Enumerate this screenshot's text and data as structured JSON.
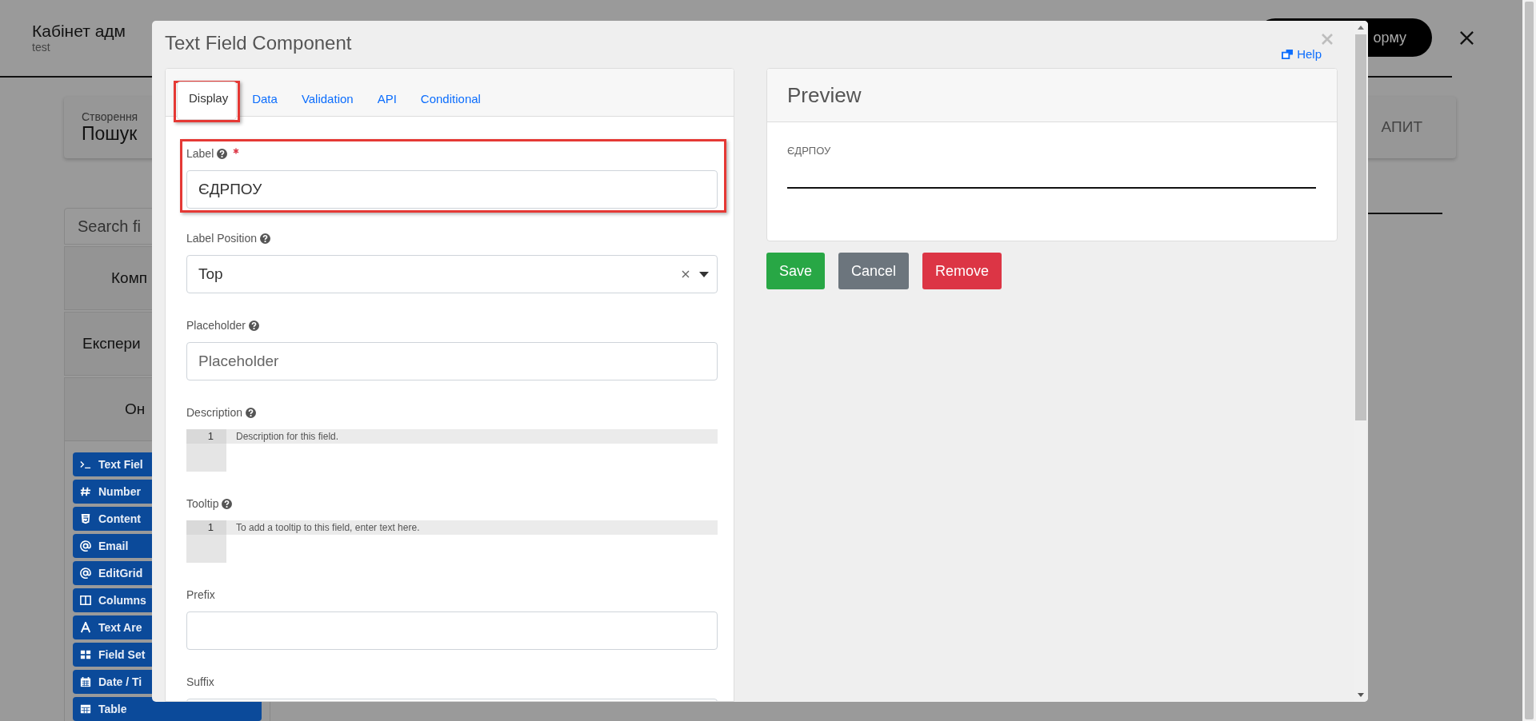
{
  "page": {
    "title": "Кабінет адм",
    "subtitle": "test",
    "header_button": "орму"
  },
  "form_card": {
    "caption": "Створення",
    "title": "Пошук",
    "action": "АПИТ"
  },
  "sidebar": {
    "search": {
      "placeholder": "Search fi"
    },
    "groups": [
      {
        "label": "Комп"
      },
      {
        "label": "Експери"
      },
      {
        "label": "Он"
      }
    ],
    "items": [
      {
        "label": "Text Fiel",
        "kind": "terminal"
      },
      {
        "label": "Number",
        "kind": "hash"
      },
      {
        "label": "Content",
        "kind": "html"
      },
      {
        "label": "Email",
        "kind": "at"
      },
      {
        "label": "EditGrid",
        "kind": "at"
      },
      {
        "label": "Columns",
        "kind": "columns"
      },
      {
        "label": "Text Are",
        "kind": "font"
      },
      {
        "label": "Field Set",
        "kind": "grid"
      },
      {
        "label": "Date / Ti",
        "kind": "calendar"
      },
      {
        "label": "Table",
        "kind": "table"
      }
    ]
  },
  "modal": {
    "title": "Text Field Component",
    "help": "Help",
    "tabs": [
      {
        "label": "Display",
        "selected": true,
        "highlighted": true
      },
      {
        "label": "Data",
        "selected": false,
        "highlighted": false
      },
      {
        "label": "Validation",
        "selected": false,
        "highlighted": false
      },
      {
        "label": "API",
        "selected": false,
        "highlighted": false
      },
      {
        "label": "Conditional",
        "selected": false,
        "highlighted": false
      }
    ],
    "fields": [
      {
        "kind": "input",
        "label": "Label",
        "help": true,
        "required": true,
        "highlighted": true,
        "value": "ЄДРПОУ"
      },
      {
        "kind": "select",
        "label": "Label Position",
        "help": true,
        "required": false,
        "highlighted": false,
        "value": "Top"
      },
      {
        "kind": "input",
        "label": "Placeholder",
        "help": true,
        "required": false,
        "highlighted": false,
        "placeholder": "Placeholder"
      },
      {
        "kind": "code",
        "label": "Description",
        "help": true,
        "required": false,
        "highlighted": false,
        "line_number": "1",
        "placeholder": "Description for this field."
      },
      {
        "kind": "code",
        "label": "Tooltip",
        "help": true,
        "required": false,
        "highlighted": false,
        "line_number": "1",
        "placeholder": "To add a tooltip to this field, enter text here."
      },
      {
        "kind": "input",
        "label": "Prefix",
        "help": false,
        "required": false,
        "highlighted": false
      },
      {
        "kind": "input",
        "label": "Suffix",
        "help": false,
        "required": false,
        "highlighted": false
      }
    ],
    "preview": {
      "title": "Preview",
      "field_label": "ЄДРПОУ"
    },
    "buttons": [
      {
        "label": "Save",
        "kind": "save"
      },
      {
        "label": "Cancel",
        "kind": "cancel"
      },
      {
        "label": "Remove",
        "kind": "remove"
      }
    ]
  }
}
